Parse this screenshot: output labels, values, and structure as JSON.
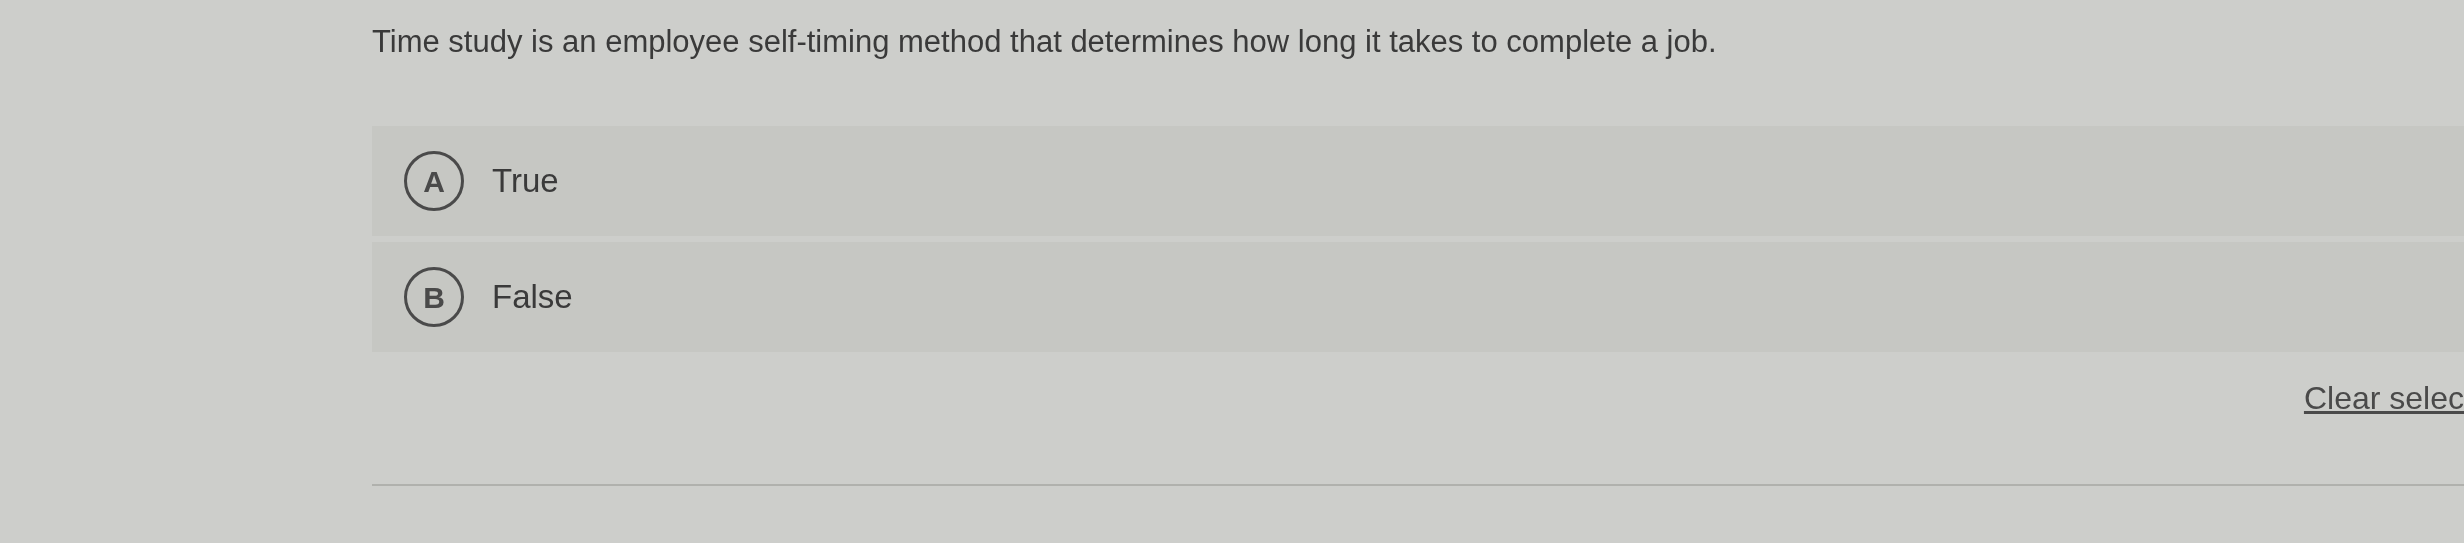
{
  "question": "Time study is an employee self-timing method that determines how long it takes to complete a job.",
  "options": [
    {
      "letter": "A",
      "label": "True",
      "selected": false
    },
    {
      "letter": "B",
      "label": "False",
      "selected": false
    }
  ],
  "clear_link": "Clear selec"
}
